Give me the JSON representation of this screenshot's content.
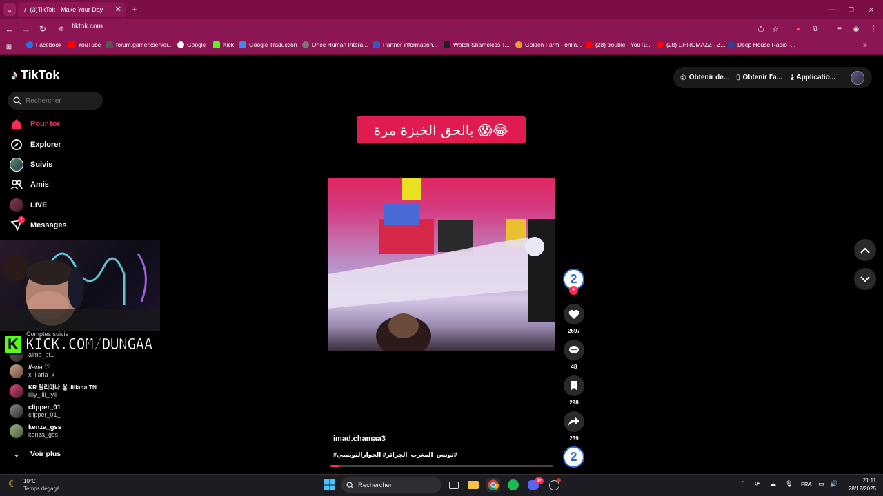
{
  "browser": {
    "tab_title": "(3)TikTok - Make Your Day",
    "url": "tiktok.com",
    "bookmarks": [
      {
        "label": "Facebook",
        "color": "#1877f2"
      },
      {
        "label": "YouTube",
        "color": "#ff0000"
      },
      {
        "label": "forum.gamerxserver...",
        "color": "#555"
      },
      {
        "label": "Google",
        "color": "#fff"
      },
      {
        "label": "Kick",
        "color": "#53fc18"
      },
      {
        "label": "Google Traduction",
        "color": "#4285f4"
      },
      {
        "label": "Once Human Intera...",
        "color": "#777"
      },
      {
        "label": "Partner information...",
        "color": "#3a56c5"
      },
      {
        "label": "Watch Shameless T...",
        "color": "#222"
      },
      {
        "label": "Golden Farm - onlin...",
        "color": "#e8a030"
      },
      {
        "label": "(28) trouble - YouTu...",
        "color": "#ff0000"
      },
      {
        "label": "(28) CHROMAZZ - Z...",
        "color": "#ff0000"
      },
      {
        "label": "Deep House Radio -...",
        "color": "#3a3a8a"
      }
    ]
  },
  "tiktok": {
    "logo": "TikTok",
    "search_placeholder": "Rechercher",
    "nav": {
      "for_you": "Pour toi",
      "explore": "Explorer",
      "following": "Suivis",
      "friends": "Amis",
      "live": "LIVE",
      "messages": "Messages",
      "messages_badge": "2"
    },
    "following_section_label": "Comptes suivis",
    "following_accounts": [
      {
        "name": "alma_pf1",
        "handle": ""
      },
      {
        "name": "Ilaria ♡",
        "handle": "x_ilaria_x"
      },
      {
        "name": "KR 릴리아나 🐰 liliana TN",
        "handle": "lilly_lili_lyli"
      },
      {
        "name": "clipper_01",
        "handle": "clipper_01_"
      },
      {
        "name": "kenza_gss",
        "handle": "kenza_gss"
      }
    ],
    "see_more": "Voir plus",
    "top_right": {
      "get_coins": "Obtenir de...",
      "get_app": "Obtenir l'a...",
      "application": "Applicatio..."
    },
    "video": {
      "banner_text": "بالحق الخبزة مرة 😱😂",
      "username": "imad.chamaa3",
      "hashtags": "#تونس_المغرب_الجزائر# الحوارالتونسي#",
      "likes": "2697",
      "comments": "48",
      "saves": "298",
      "shares": "239",
      "progress_fraction": 0.04
    }
  },
  "overlay": {
    "kick_text": "KICK.COM/DUNGAA"
  },
  "taskbar": {
    "weather_temp": "10°C",
    "weather_desc": "Temps dégagé",
    "search_placeholder": "Rechercher",
    "language": "FRA",
    "time": "21:11",
    "date": "28/12/2025",
    "discord_badge": "9+"
  }
}
